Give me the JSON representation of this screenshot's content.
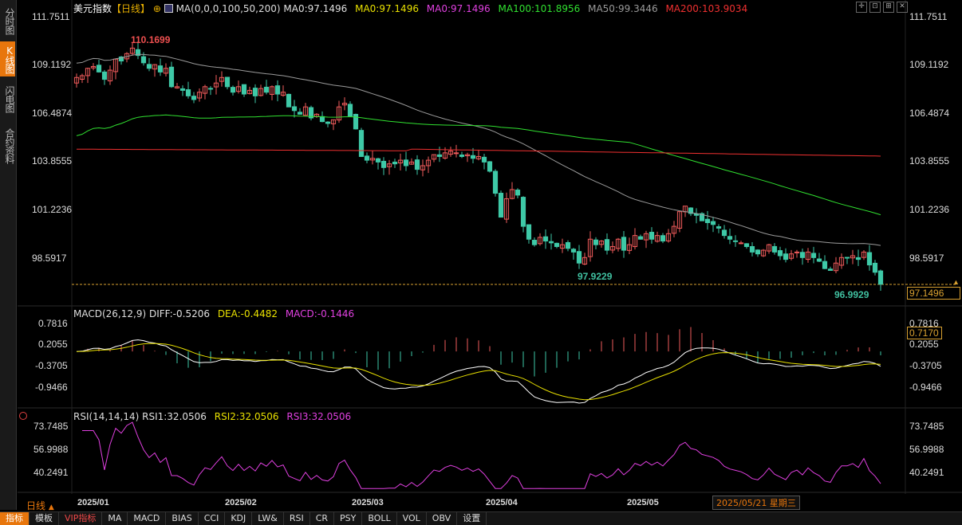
{
  "sidebar": {
    "tabs": [
      {
        "label": "分时图",
        "active": false
      },
      {
        "label": "K线图",
        "active": true
      },
      {
        "label": "闪电图",
        "active": false
      },
      {
        "label": "合约资料",
        "active": false
      }
    ]
  },
  "header": {
    "title": "美元指数",
    "period": "【日线】",
    "add_icon": "plus-circle-icon",
    "ma_label": "MA(0,0,0,100,50,200)",
    "ma_items": [
      {
        "label": "MA0:97.1496",
        "color": "#e0e0e0"
      },
      {
        "label": "MA0:97.1496",
        "color": "#e8e000"
      },
      {
        "label": "MA0:97.1496",
        "color": "#e040e0"
      },
      {
        "label": "MA100:101.8956",
        "color": "#30e030"
      },
      {
        "label": "MA50:99.3446",
        "color": "#9a9a9a"
      },
      {
        "label": "MA200:103.9034",
        "color": "#f03030"
      }
    ]
  },
  "window_controls": [
    "expand-icon",
    "contract-icon",
    "grid-icon",
    "close-icon"
  ],
  "price_axis": {
    "ticks": [
      "111.7511",
      "109.1192",
      "106.4874",
      "103.8555",
      "101.2236",
      "98.5917"
    ],
    "tick_values": [
      111.7511,
      109.1192,
      106.4874,
      103.8555,
      101.2236,
      98.5917
    ],
    "current_price": "97.1496",
    "current_value": 97.1496
  },
  "annotations": {
    "high": "110.1699",
    "low1": "97.9229",
    "low2": "96.9929"
  },
  "macd": {
    "header": "MACD(26,12,9)",
    "diff": "DIFF:-0.5206",
    "dea": "DEA:-0.4482",
    "macd": "MACD:-0.1446",
    "ticks": [
      "0.7816",
      "0.2055",
      "-0.3705",
      "-0.9466"
    ],
    "tick_values": [
      0.7816,
      0.2055,
      -0.3705,
      -0.9466
    ],
    "current": "0.7170"
  },
  "rsi": {
    "header": "RSI(14,14,14)",
    "rsi1": "RSI1:32.0506",
    "rsi2": "RSI2:32.0506",
    "rsi3": "RSI3:32.0506",
    "ticks": [
      "73.7485",
      "56.9988",
      "40.2491"
    ],
    "tick_values": [
      73.7485,
      56.9988,
      40.2491
    ],
    "rsi_icon": "target-icon"
  },
  "time_axis": {
    "labels": [
      "2025/01",
      "2025/02",
      "2025/03",
      "2025/04",
      "2025/05"
    ],
    "cursor_date": "2025/05/21 星期三"
  },
  "period_selector": {
    "label": "日线",
    "icon": "triangle-up-icon"
  },
  "bottom_tabs": [
    {
      "label": "指标",
      "active": true
    },
    {
      "label": "模板",
      "active": false
    },
    {
      "label": "VIP指标",
      "active": false,
      "vip": true
    },
    {
      "label": "MA",
      "active": false
    },
    {
      "label": "MACD",
      "active": false
    },
    {
      "label": "BIAS",
      "active": false
    },
    {
      "label": "CCI",
      "active": false
    },
    {
      "label": "KDJ",
      "active": false
    },
    {
      "label": "LW&",
      "active": false
    },
    {
      "label": "RSI",
      "active": false
    },
    {
      "label": "CR",
      "active": false
    },
    {
      "label": "PSY",
      "active": false
    },
    {
      "label": "BOLL",
      "active": false
    },
    {
      "label": "VOL",
      "active": false
    },
    {
      "label": "OBV",
      "active": false
    },
    {
      "label": "设置",
      "active": false
    }
  ],
  "chart_data": {
    "type": "candlestick",
    "title": "美元指数",
    "x_labels": [
      "2025/01",
      "2025/02",
      "2025/03",
      "2025/04",
      "2025/05"
    ],
    "y_range": [
      96.9929,
      111.7511
    ],
    "closes": [
      108.4,
      108.5,
      108.9,
      109.0,
      108.7,
      108.3,
      108.8,
      109.4,
      109.3,
      109.7,
      110.0,
      109.6,
      109.2,
      108.9,
      109.1,
      108.7,
      108.9,
      107.9,
      107.9,
      107.7,
      107.4,
      107.2,
      107.6,
      107.9,
      107.8,
      108.1,
      108.4,
      107.9,
      107.6,
      107.9,
      107.5,
      107.7,
      107.4,
      107.8,
      107.6,
      107.9,
      107.5,
      107.6,
      106.8,
      106.6,
      106.4,
      106.8,
      106.2,
      106.4,
      106.0,
      105.9,
      106.1,
      106.8,
      107.0,
      106.3,
      105.6,
      104.1,
      103.9,
      104.0,
      103.8,
      103.5,
      103.7,
      103.7,
      103.9,
      103.6,
      103.8,
      103.4,
      103.6,
      103.9,
      104.2,
      104.1,
      104.3,
      104.4,
      104.3,
      104.1,
      104.2,
      104.0,
      104.1,
      103.8,
      103.3,
      102.1,
      100.8,
      101.8,
      102.3,
      102.0,
      100.3,
      99.6,
      99.3,
      99.7,
      99.5,
      99.4,
      99.2,
      99.3,
      99.1,
      98.9,
      98.3,
      98.6,
      99.6,
      99.3,
      99.5,
      99.0,
      99.2,
      99.6,
      99.0,
      99.3,
      99.8,
      99.6,
      99.9,
      99.6,
      99.8,
      99.5,
      99.9,
      100.3,
      101.1,
      101.4,
      101.0,
      100.9,
      100.6,
      100.5,
      100.4,
      100.2,
      99.8,
      99.6,
      99.5,
      99.4,
      99.2,
      98.9,
      98.8,
      99.0,
      99.3,
      98.9,
      98.7,
      98.5,
      98.8,
      98.9,
      98.6,
      98.9,
      98.6,
      98.4,
      98.0,
      97.9,
      98.3,
      98.6,
      98.6,
      98.7,
      98.5,
      98.9,
      98.2,
      97.8,
      97.15
    ]
  }
}
